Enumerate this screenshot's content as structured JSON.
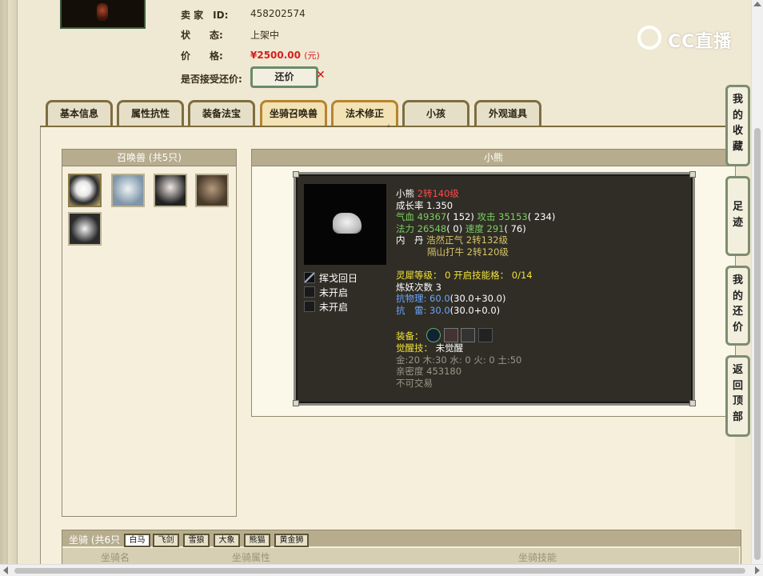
{
  "seller": {
    "id_label": "卖 家　ID:",
    "id_value": "458202574",
    "status_label": "状　　态:",
    "status_value": "上架中",
    "price_label": "价　　格:",
    "price_value": "¥2500.00",
    "price_unit": "(元)",
    "bargain_label": "是否接受还价:",
    "bargain_button": "还价"
  },
  "watermark": {
    "text": "CC直播"
  },
  "tabs": [
    {
      "label": "基本信息"
    },
    {
      "label": "属性抗性"
    },
    {
      "label": "装备法宝"
    },
    {
      "label": "坐骑召唤兽",
      "active": true
    },
    {
      "label": "法术修正"
    },
    {
      "label": "小孩"
    },
    {
      "label": "外观道具"
    }
  ],
  "summon_panel": {
    "title": "召唤兽 (共5只)"
  },
  "detail_panel": {
    "title": "小熊",
    "skills": [
      "挥戈回日",
      "未开启",
      "未开启"
    ],
    "name": "小熊",
    "level": "2转140级",
    "growth": "成长率 1.350",
    "hp_label": "气血",
    "hp_value": "49367",
    "hp_extra": "( 152)",
    "atk_label": "攻击",
    "atk_value": "35153",
    "atk_extra": "( 234)",
    "mp_label": "法力",
    "mp_value": "26548",
    "mp_extra": "( 0)",
    "spd_label": "速度",
    "spd_value": "291",
    "spd_extra": "( 76)",
    "neidan_label": "内　丹",
    "neidan_1": "浩然正气 2转132级",
    "neidan_2": "隔山打牛 2转120级",
    "spirit": "灵犀等级： 0 开启技能格： 0/14",
    "refine": "炼妖次数 3",
    "resist_phys_label": "抗物理:",
    "resist_phys_value": "60.0",
    "resist_phys_detail": "(30.0+30.0)",
    "resist_thunder_label": "抗　雷:",
    "resist_thunder_value": "30.0",
    "resist_thunder_detail": "(30.0+0.0)",
    "equip_label": "装备：",
    "awaken_label": "觉醒技：",
    "awaken_value": "未觉醒",
    "elements": "金:20 木:30 水: 0 火: 0 土:50",
    "intimacy": "亲密度 453180",
    "tradable": "不可交易"
  },
  "side_buttons": [
    "我的收藏",
    "足迹",
    "我的还价",
    "返回顶部"
  ],
  "mount_panel": {
    "title": "坐骑 (共6只",
    "subtabs": [
      "白马",
      "飞剑",
      "雪狼",
      "大象",
      "熊猫",
      "黄金狮"
    ],
    "columns": [
      "坐骑名",
      "坐骑属性",
      "坐骑技能"
    ]
  },
  "colors": {
    "price": "#d61e1e",
    "tab_active": "#b8842c",
    "card_bg": "#2f2d25"
  }
}
